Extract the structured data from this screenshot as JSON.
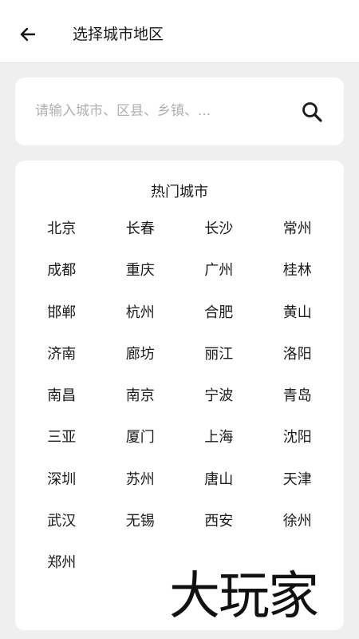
{
  "header": {
    "back_icon": "arrow-left-icon",
    "title": "选择城市地区"
  },
  "search": {
    "placeholder": "请输入城市、区县、乡镇、...",
    "value": "",
    "icon": "search-icon"
  },
  "hot_cities": {
    "title": "热门城市",
    "cities": [
      "北京",
      "长春",
      "长沙",
      "常州",
      "成都",
      "重庆",
      "广州",
      "桂林",
      "邯郸",
      "杭州",
      "合肥",
      "黄山",
      "济南",
      "廊坊",
      "丽江",
      "洛阳",
      "南昌",
      "南京",
      "宁波",
      "青岛",
      "三亚",
      "厦门",
      "上海",
      "沈阳",
      "深圳",
      "苏州",
      "唐山",
      "天津",
      "武汉",
      "无锡",
      "西安",
      "徐州",
      "郑州"
    ]
  },
  "watermark": {
    "text": "大玩家"
  },
  "colors": {
    "background": "#efefef",
    "card": "#ffffff",
    "text": "#1a1a1a",
    "placeholder": "#b0b0b0"
  }
}
